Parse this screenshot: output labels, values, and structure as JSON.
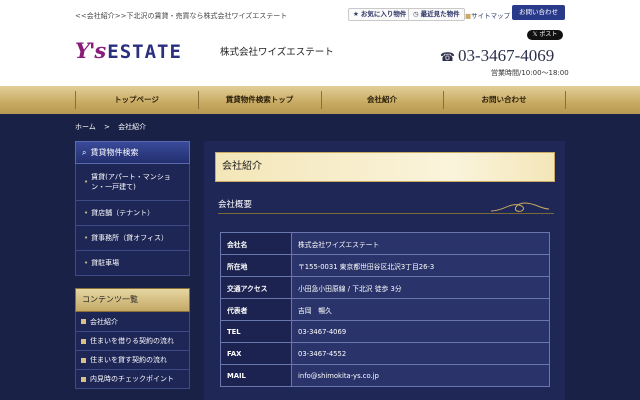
{
  "header": {
    "tagline": "<<会社紹介>>下北沢の賃貸・売買なら株式会社ワイズエステート",
    "favorites": "お気に入り物件",
    "recent": "最近見た物件",
    "sitemap": "サイトマップ",
    "contact": "お問い合わせ",
    "x_post": "ポスト",
    "logo_ys": "Y's",
    "logo_estate": "ESTATE",
    "company": "株式会社ワイズエステート",
    "phone": "03-3467-4069",
    "hours": "営業時間/10:00～18:00"
  },
  "nav": [
    "トップページ",
    "賃貸物件検索トップ",
    "会社紹介",
    "お問い合わせ"
  ],
  "breadcrumb": {
    "home": "ホーム",
    "sep": ">",
    "current": "会社紹介"
  },
  "sidebar": {
    "search_title": "賃貸物件検索",
    "search_items": [
      "賃貸(アパート・マンション・一戸建て)",
      "貸店舗（テナント）",
      "貸事務所（貸オフィス）",
      "貸駐車場"
    ],
    "contents_title": "コンテンツ一覧",
    "contents_items": [
      "会社紹介",
      "住まいを借りる契約の流れ",
      "住まいを貸す契約の流れ",
      "内見時のチェックポイント"
    ]
  },
  "main": {
    "title": "会社紹介",
    "section": "会社概要",
    "rows": [
      {
        "label": "会社名",
        "value": "株式会社ワイズエステート"
      },
      {
        "label": "所在地",
        "value": "〒155-0031 東京都世田谷区北沢3丁目26-3"
      },
      {
        "label": "交通アクセス",
        "value": "小田急小田原線 / 下北沢 徒歩 3分"
      },
      {
        "label": "代表者",
        "value": "吉岡　暢久"
      },
      {
        "label": "TEL",
        "value": "03-3467-4069"
      },
      {
        "label": "FAX",
        "value": "03-3467-4552"
      },
      {
        "label": "MAIL",
        "value": "info@shimokita-ys.co.jp"
      }
    ]
  },
  "colors": {
    "navy": "#1a2147",
    "gold": "#c8aa62",
    "brand_purple": "#8a1c7a",
    "brand_blue": "#2b2f80"
  }
}
